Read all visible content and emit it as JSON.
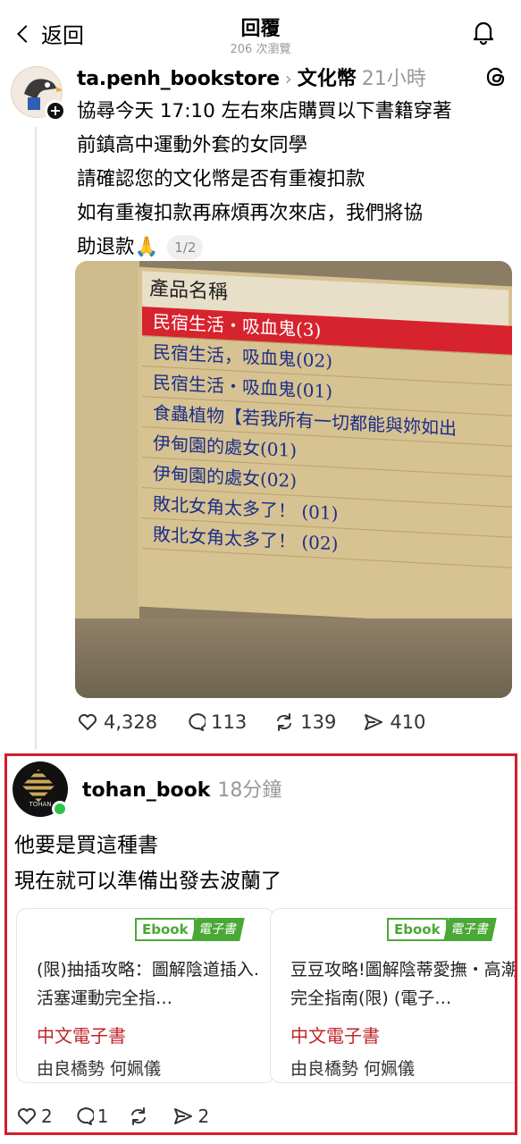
{
  "header": {
    "back_label": "返回",
    "title": "回覆",
    "views": "206 次瀏覽"
  },
  "post": {
    "username": "ta.penh_bookstore",
    "tag": "文化幣",
    "time": "21小時",
    "lines": [
      "協尋今天 17:10 左右來店購買以下書籍穿著",
      "前鎮高中運動外套的女同學",
      "請確認您的文化幣是否有重複扣款",
      "如有重複扣款再麻煩再次來店，我們將協",
      "助退款🙏"
    ],
    "pager": "1/2",
    "photo": {
      "column_header": "產品名稱",
      "rows": [
        "民宿生活・吸血鬼(3)",
        "民宿生活，吸血鬼(02)",
        "民宿生活・吸血鬼(01)",
        "食蟲植物【若我所有一切都能與妳如出",
        "伊甸園的處女(01)",
        "伊甸園的處女(02)",
        "敗北女角太多了！ (01)",
        "敗北女角太多了！ (02)"
      ]
    },
    "stats": {
      "likes": "4,328",
      "comments": "113",
      "reposts": "139",
      "shares": "410"
    }
  },
  "reply": {
    "username": "tohan_book",
    "time": "18分鐘",
    "avatar_text": "TOHAN",
    "lines": [
      "他要是買這種書",
      "現在就可以準備出發去波蘭了"
    ],
    "cards": [
      {
        "badge_en": "Ebook",
        "badge_zh": "電子書",
        "title": "(限)抽插攻略：圖解陰道插入.活塞運動完全指…",
        "category": "中文電子書",
        "author": "由良橋勢  何姵儀"
      },
      {
        "badge_en": "Ebook",
        "badge_zh": "電子書",
        "title": "豆豆攻略!圖解陰蒂愛撫・高潮完全指南(限) (電子…",
        "category": "中文電子書",
        "author": "由良橋勢  何姵儀"
      }
    ],
    "stats": {
      "likes": "2",
      "comments": "1",
      "reposts": "",
      "shares": "2"
    }
  }
}
